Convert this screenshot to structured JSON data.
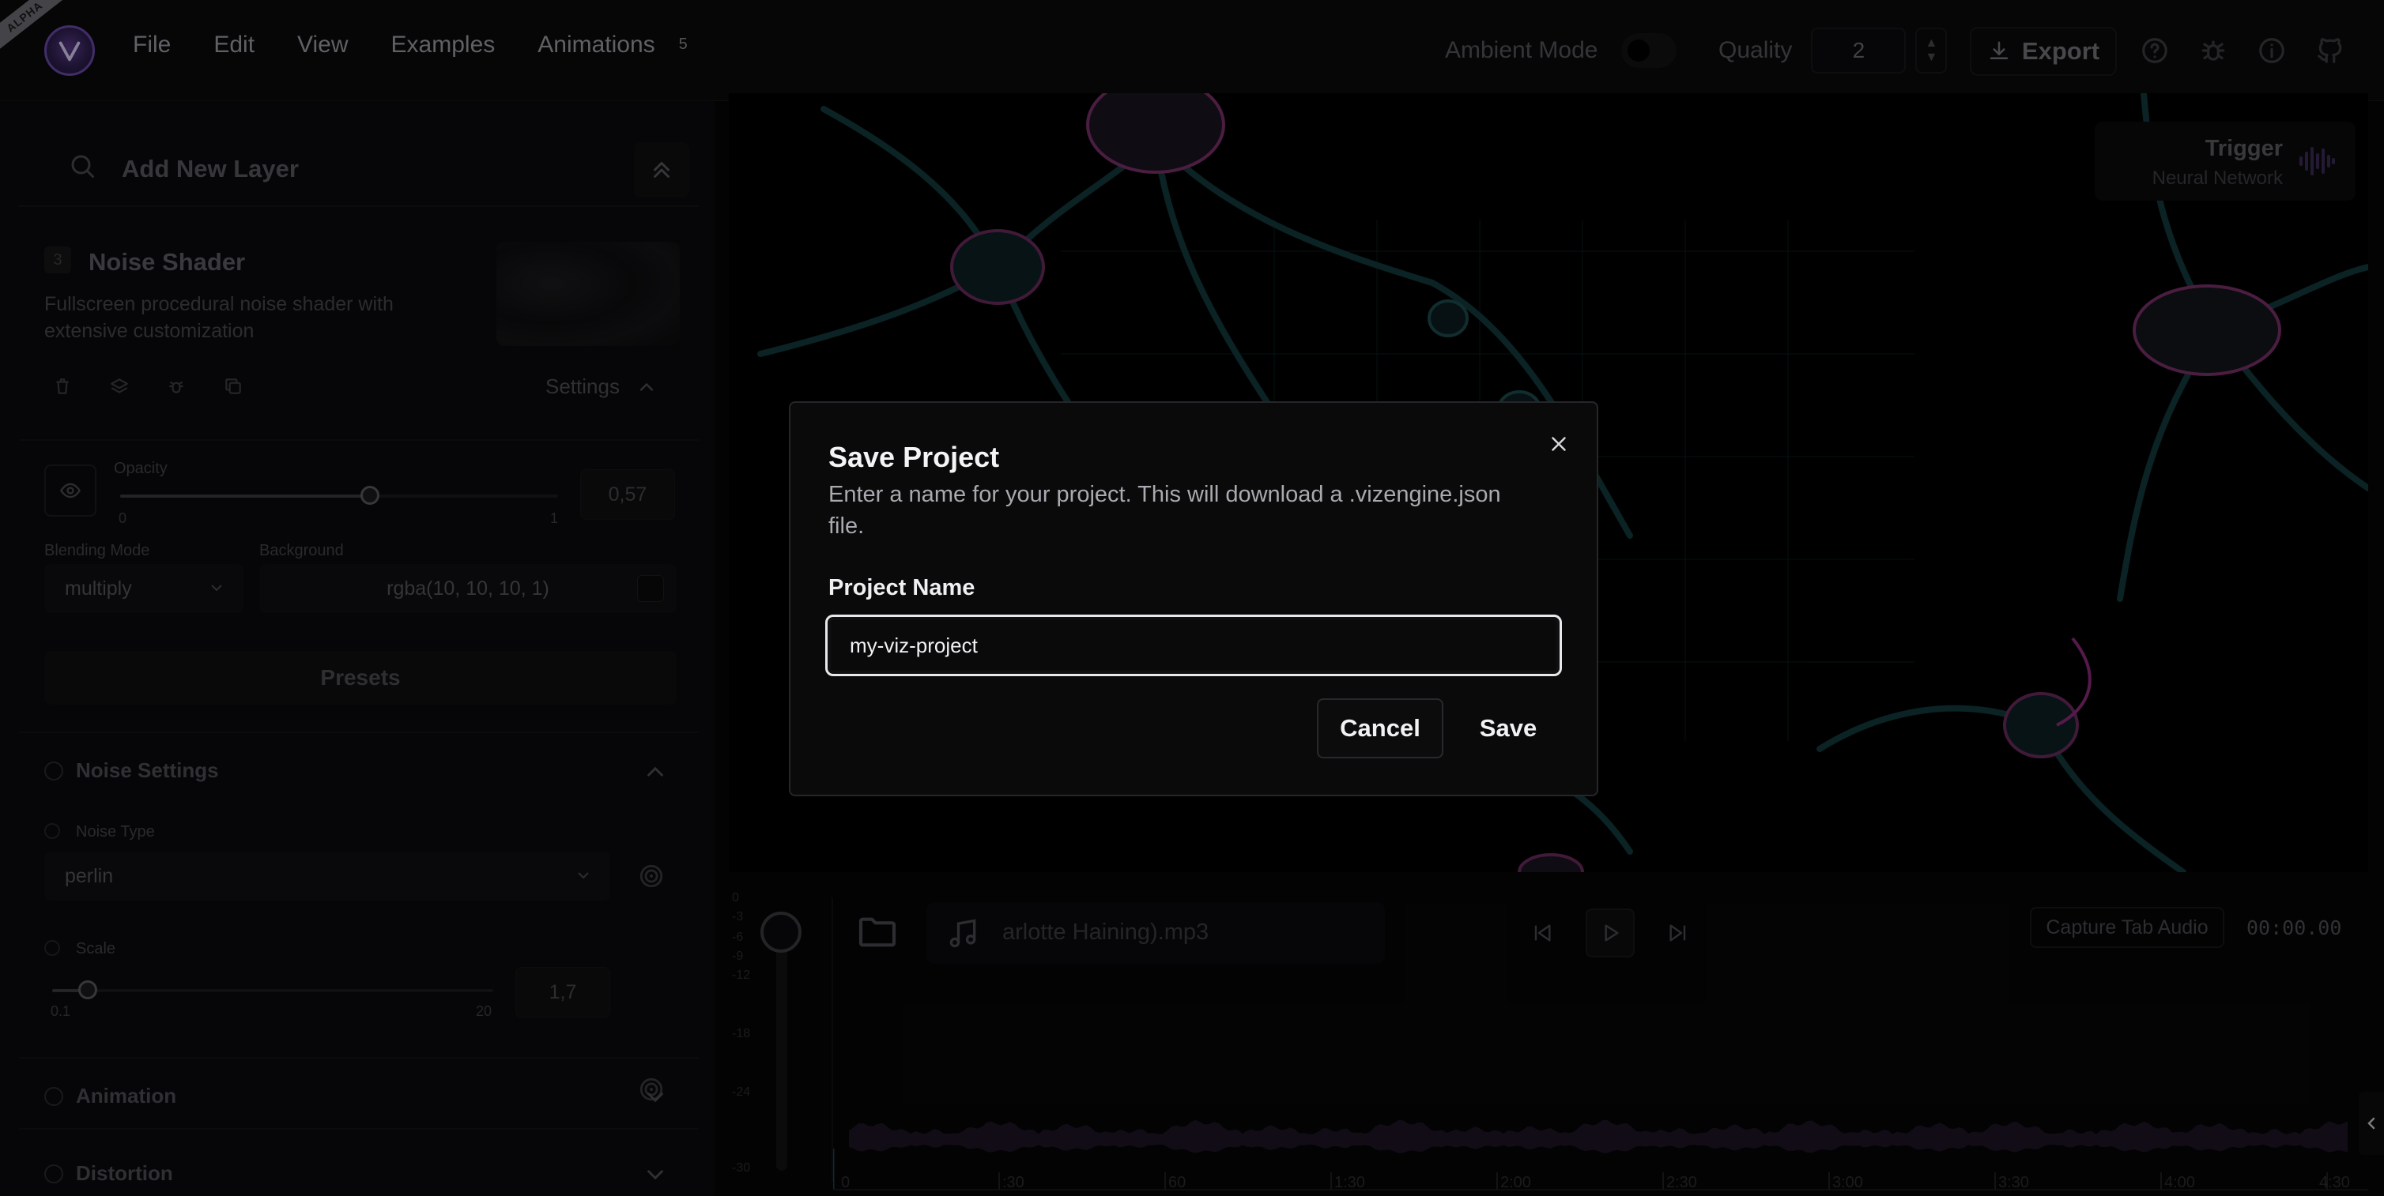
{
  "app": {
    "badge": "ALPHA",
    "menu": [
      {
        "label": "File"
      },
      {
        "label": "Edit"
      },
      {
        "label": "View"
      },
      {
        "label": "Examples"
      },
      {
        "label": "Animations"
      }
    ],
    "animations_count": "5",
    "ambient_label": "Ambient Mode",
    "quality_label": "Quality",
    "quality_value": "2",
    "export_label": "Export",
    "top_icons": [
      "help-icon",
      "bug-icon",
      "info-icon",
      "github-icon"
    ]
  },
  "left_panel": {
    "search_placeholder": "Add New Layer",
    "layer": {
      "number": "3",
      "title": "Noise Shader",
      "description": "Fullscreen procedural noise shader with extensive customization",
      "settings_label": "Settings"
    },
    "opacity": {
      "label": "Opacity",
      "value": "0,57",
      "min": "0",
      "max": "1",
      "fraction": 0.57
    },
    "blending": {
      "label": "Blending Mode",
      "value": "multiply"
    },
    "background": {
      "label": "Background",
      "value": "rgba(10, 10, 10, 1)"
    },
    "presets_label": "Presets",
    "noise_settings": {
      "title": "Noise Settings",
      "type_label": "Noise Type",
      "type_value": "perlin",
      "scale_label": "Scale",
      "scale_value": "1,7",
      "scale_min": "0.1",
      "scale_max": "20",
      "scale_fraction": 0.08
    },
    "sections": [
      {
        "title": "Animation"
      },
      {
        "title": "Distortion"
      }
    ]
  },
  "preview": {
    "trigger_title": "Trigger",
    "trigger_subtitle": "Neural Network"
  },
  "audio": {
    "db_ticks": [
      "0",
      "-3",
      "-6",
      "-9",
      "-12",
      "-18",
      "-24",
      "-30"
    ],
    "track_name": "arlotte Haining).mp3",
    "capture_label": "Capture Tab Audio",
    "time": "00:00.00",
    "timeline": [
      "0",
      ":30",
      "60",
      "1:30",
      "2:00",
      "2:30",
      "3:00",
      "3:30",
      "4:00",
      "4:30"
    ]
  },
  "modal": {
    "title": "Save Project",
    "description": "Enter a name for your project. This will download a .vizengine.json file.",
    "field_label": "Project Name",
    "field_value": "my-viz-project",
    "cancel_label": "Cancel",
    "save_label": "Save"
  },
  "colors": {
    "accent": "#6a4aa8",
    "modal_bg": "#0a0a0b",
    "input_border": "#e9e9ec"
  }
}
